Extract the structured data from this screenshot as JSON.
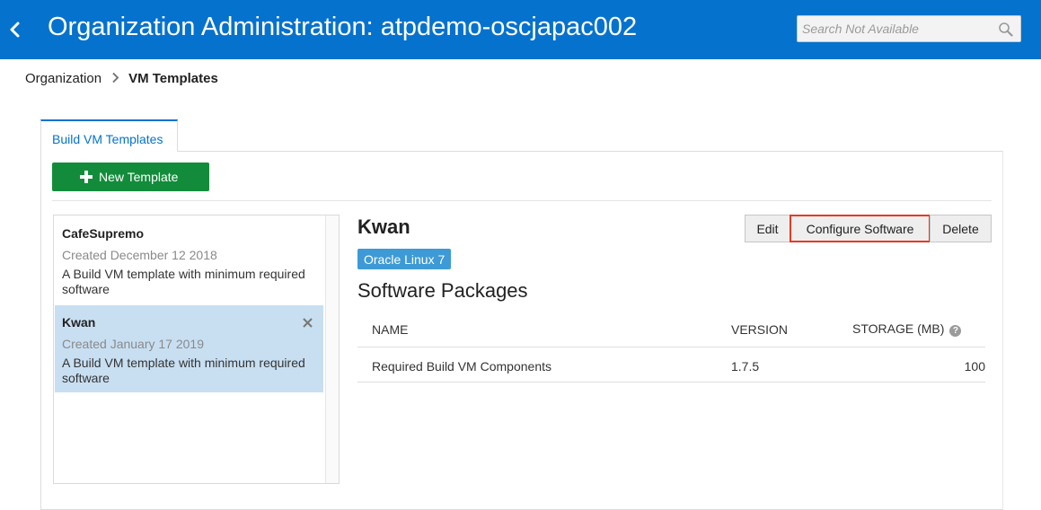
{
  "header": {
    "title": "Organization Administration: atpdemo-oscjapac002",
    "search_placeholder": "Search Not Available",
    "background": "#0572ce"
  },
  "breadcrumb": {
    "parent": "Organization",
    "current": "VM Templates"
  },
  "tabs": [
    {
      "label": "Build VM Templates",
      "active": true
    }
  ],
  "toolbar": {
    "new_template_label": "New Template"
  },
  "templates": [
    {
      "name": "CafeSupremo",
      "created": "Created December 12 2018",
      "description": "A Build VM template with minimum required software",
      "selected": false
    },
    {
      "name": "Kwan",
      "created": "Created January 17 2019",
      "description": "A Build VM template with minimum required software",
      "selected": true
    }
  ],
  "detail": {
    "name": "Kwan",
    "os_badge": "Oracle Linux 7",
    "edit_label": "Edit",
    "configure_label": "Configure Software",
    "delete_label": "Delete",
    "section_title": "Software Packages",
    "columns": {
      "name": "NAME",
      "version": "VERSION",
      "storage": "STORAGE (MB)"
    },
    "packages": [
      {
        "name": "Required Build VM Components",
        "version": "1.7.5",
        "storage": "100"
      }
    ]
  },
  "colors": {
    "accent": "#0572ce",
    "new_button": "#128c3a",
    "selected_row": "#c8dff2",
    "highlight_border": "#e53a22",
    "os_badge": "#3d9ad6"
  }
}
